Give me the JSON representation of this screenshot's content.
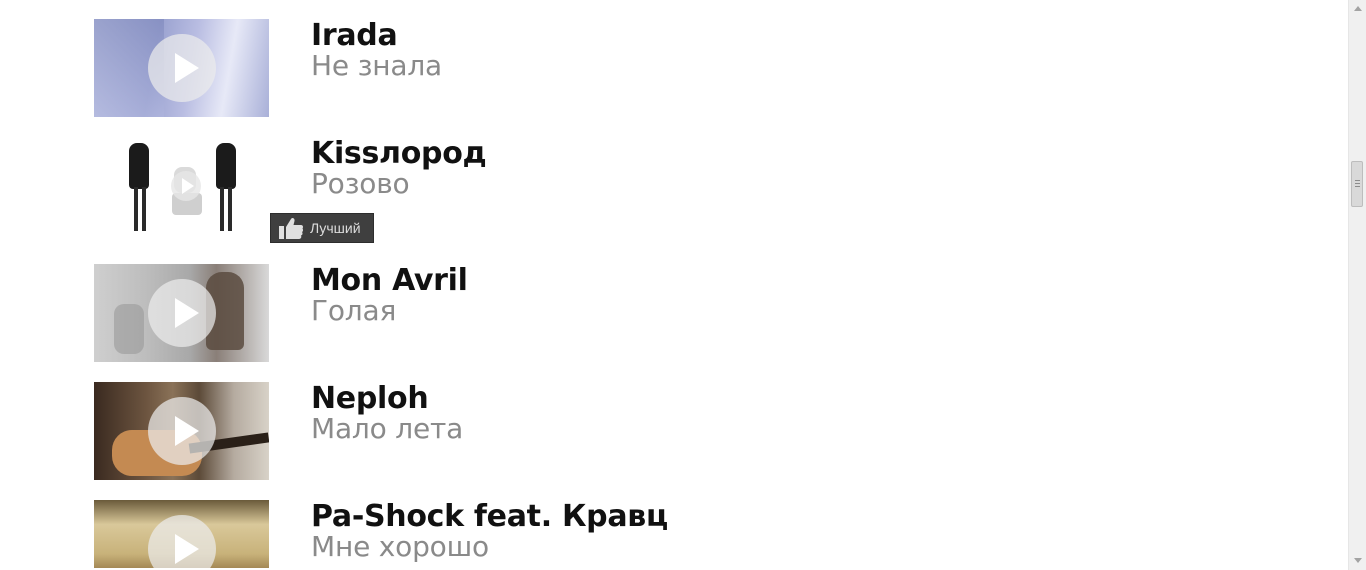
{
  "items": [
    {
      "artist": "Irada",
      "song": "Не знала"
    },
    {
      "artist": "Kissлород",
      "song": "Розово"
    },
    {
      "artist": "Mon Avril",
      "song": "Голая"
    },
    {
      "artist": "Neploh",
      "song": "Мало лета"
    },
    {
      "artist": "Pa-Shock feat. Кравц",
      "song": "Мне хорошо"
    }
  ],
  "like_button": {
    "label": "Лучший",
    "icon": "thumbs-up-icon"
  },
  "icons": {
    "play": "play-icon"
  }
}
